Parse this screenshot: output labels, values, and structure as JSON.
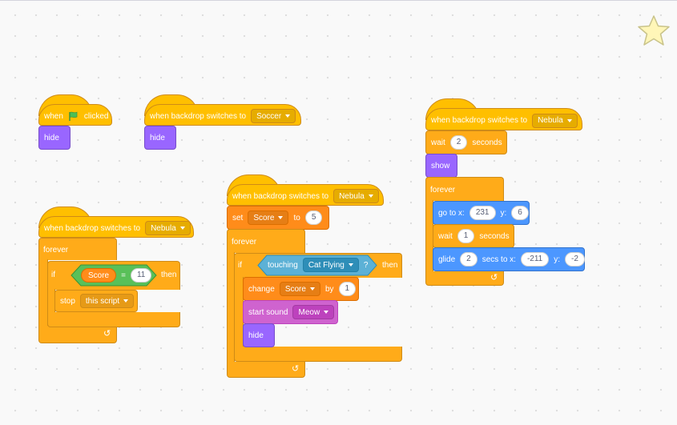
{
  "colors": {
    "events": "#ffbf00",
    "control": "#ffab19",
    "looks": "#9966ff",
    "variables": "#ff8c1a",
    "motion": "#4c97ff",
    "sound": "#cf63cf",
    "sensing": "#5cb1d6",
    "operators": "#59c059"
  },
  "script1": {
    "when": "when",
    "clicked": "clicked",
    "hide": "hide"
  },
  "script2": {
    "label": "when backdrop switches to",
    "backdrop": "Soccer",
    "hide": "hide"
  },
  "script3": {
    "label": "when backdrop switches to",
    "backdrop": "Nebula",
    "forever": "forever",
    "if": "if",
    "var": "Score",
    "eq": "=",
    "value": "11",
    "then": "then",
    "stop": "stop",
    "stop_option": "this script"
  },
  "script4": {
    "label": "when backdrop switches to",
    "backdrop": "Nebula",
    "set": "set",
    "set_var": "Score",
    "to": "to",
    "set_value": "5",
    "forever": "forever",
    "if": "if",
    "touching": "touching",
    "touch_target": "Cat Flying",
    "q": "?",
    "then": "then",
    "change": "change",
    "change_var": "Score",
    "by": "by",
    "change_value": "1",
    "start_sound": "start sound",
    "sound": "Meow",
    "hide": "hide"
  },
  "script5": {
    "label": "when backdrop switches to",
    "backdrop": "Nebula",
    "wait": "wait",
    "wait_value": "2",
    "seconds": "seconds",
    "show": "show",
    "forever": "forever",
    "goto": "go to x:",
    "goto_x": "231",
    "y": "y:",
    "goto_y": "6",
    "wait2": "wait",
    "wait2_value": "1",
    "seconds2": "seconds",
    "glide": "glide",
    "glide_secs": "2",
    "secs_to_x": "secs to x:",
    "glide_x": "-211",
    "y2": "y:",
    "glide_y": "-2"
  },
  "icons": {
    "green_flag": "green-flag-icon",
    "loop_arrow": "loop-arrow-icon",
    "favorite_star": "star-icon"
  }
}
